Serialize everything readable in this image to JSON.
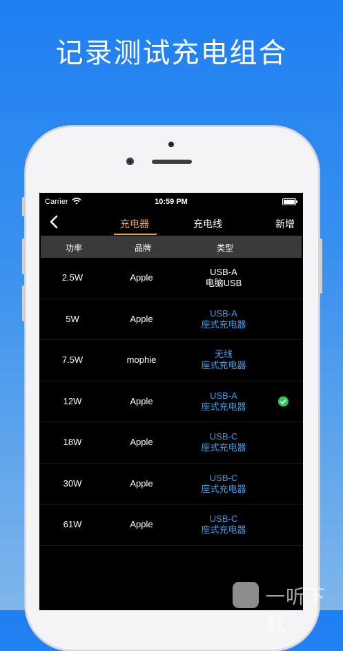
{
  "headline": "记录测试充电组合",
  "status_bar": {
    "carrier": "Carrier",
    "time": "10:59 PM"
  },
  "nav": {
    "tab_active": "充电器",
    "tab_inactive": "充电线",
    "add_label": "新增"
  },
  "table": {
    "headers": {
      "power": "功率",
      "brand": "品牌",
      "type": "类型"
    },
    "rows": [
      {
        "power": "2.5W",
        "brand": "Apple",
        "type_line1": "USB-A",
        "type_line2": "电脑USB",
        "type_color": "white",
        "selected": false
      },
      {
        "power": "5W",
        "brand": "Apple",
        "type_line1": "USB-A",
        "type_line2": "座式充电器",
        "type_color": "blue",
        "selected": false
      },
      {
        "power": "7.5W",
        "brand": "mophie",
        "type_line1": "无线",
        "type_line2": "座式充电器",
        "type_color": "blue",
        "selected": false
      },
      {
        "power": "12W",
        "brand": "Apple",
        "type_line1": "USB-A",
        "type_line2": "座式充电器",
        "type_color": "blue",
        "selected": true
      },
      {
        "power": "18W",
        "brand": "Apple",
        "type_line1": "USB-C",
        "type_line2": "座式充电器",
        "type_color": "blue",
        "selected": false
      },
      {
        "power": "30W",
        "brand": "Apple",
        "type_line1": "USB-C",
        "type_line2": "座式充电器",
        "type_color": "blue",
        "selected": false
      },
      {
        "power": "61W",
        "brand": "Apple",
        "type_line1": "USB-C",
        "type_line2": "座式充电器",
        "type_color": "blue",
        "selected": false
      }
    ]
  },
  "colors": {
    "accent": "#f5a33c",
    "type_blue": "#3d9ee8",
    "check_green": "#34c759",
    "header_bg": "#3a3a3c"
  },
  "icons": {
    "back": "chevron-left-icon",
    "selected": "checkmark-circle-icon",
    "wifi": "wifi-icon",
    "battery": "battery-icon"
  },
  "watermark": {
    "text": "一听下载"
  }
}
